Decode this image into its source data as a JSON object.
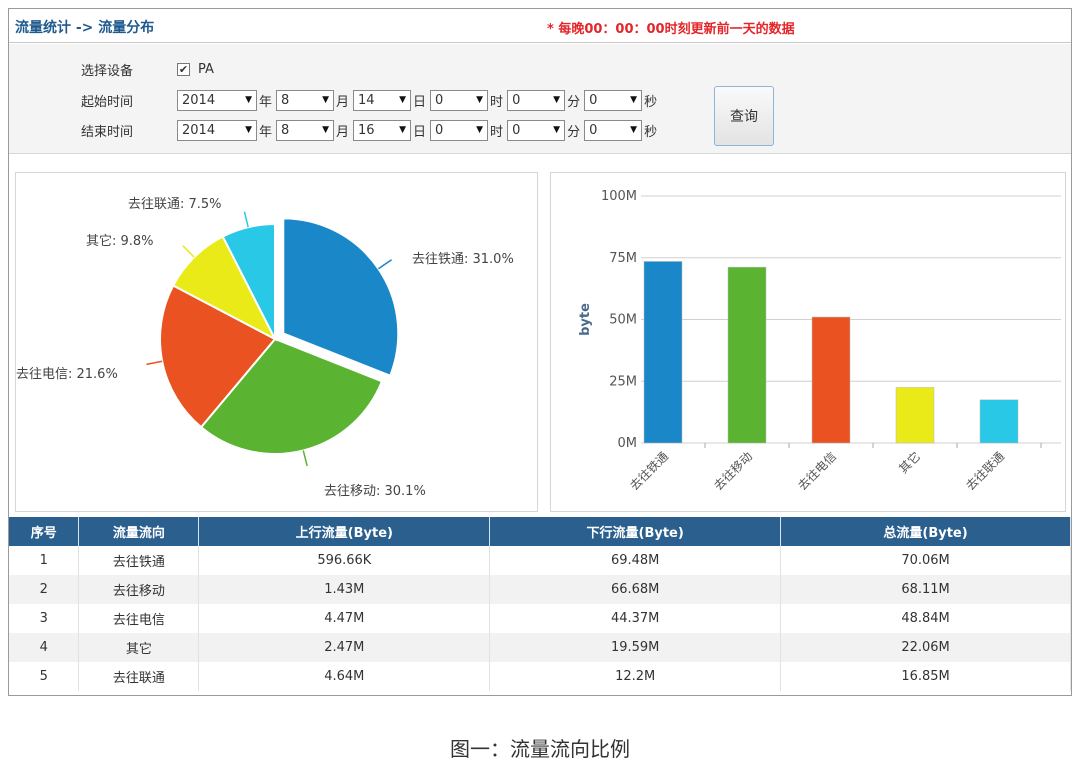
{
  "header": {
    "breadcrumb": "流量统计 -> 流量分布",
    "notice": "* 每晚00：00：00时刻更新前一天的数据"
  },
  "filters": {
    "device_label": "选择设备",
    "device_name": "PA",
    "device_checked": true,
    "start_label": "起始时间",
    "end_label": "结束时间",
    "start": {
      "year": "2014",
      "month": "8",
      "day": "14",
      "hour": "0",
      "minute": "0",
      "second": "0"
    },
    "end": {
      "year": "2014",
      "month": "8",
      "day": "16",
      "hour": "0",
      "minute": "0",
      "second": "0"
    },
    "units": {
      "year": "年",
      "month": "月",
      "day": "日",
      "hour": "时",
      "minute": "分",
      "second": "秒"
    },
    "query_label": "查询"
  },
  "chart_data": [
    {
      "type": "pie",
      "categories": [
        "去往铁通",
        "去往移动",
        "去往电信",
        "其它",
        "去往联通"
      ],
      "values": [
        31.0,
        30.1,
        21.6,
        9.8,
        7.5
      ],
      "labels": [
        "去往铁通: 31.0%",
        "去往移动: 30.1%",
        "去往电信: 21.6%",
        "其它: 9.8%",
        "去往联通: 7.5%"
      ],
      "colors": [
        "#1a87c9",
        "#5ab331",
        "#ea5321",
        "#eaea18",
        "#28c8e6"
      ],
      "exploded": "去往铁通"
    },
    {
      "type": "bar",
      "categories": [
        "去往铁通",
        "去往移动",
        "去往电信",
        "其它",
        "去往联通"
      ],
      "values": [
        73.5,
        71.2,
        51.0,
        22.5,
        17.5
      ],
      "colors": [
        "#1a87c9",
        "#5ab331",
        "#ea5321",
        "#eaea18",
        "#28c8e6"
      ],
      "ylabel": "byte",
      "ylim": [
        0,
        100
      ],
      "yticks": [
        "0M",
        "25M",
        "50M",
        "75M",
        "100M"
      ],
      "grid": true
    }
  ],
  "table": {
    "headers": [
      "序号",
      "流量流向",
      "上行流量(Byte)",
      "下行流量(Byte)",
      "总流量(Byte)"
    ],
    "rows": [
      [
        "1",
        "去往铁通",
        "596.66K",
        "69.48M",
        "70.06M"
      ],
      [
        "2",
        "去往移动",
        "1.43M",
        "66.68M",
        "68.11M"
      ],
      [
        "3",
        "去往电信",
        "4.47M",
        "44.37M",
        "48.84M"
      ],
      [
        "4",
        "其它",
        "2.47M",
        "19.59M",
        "22.06M"
      ],
      [
        "5",
        "去往联通",
        "4.64M",
        "12.2M",
        "16.85M"
      ]
    ]
  },
  "caption": "图一：流量流向比例"
}
